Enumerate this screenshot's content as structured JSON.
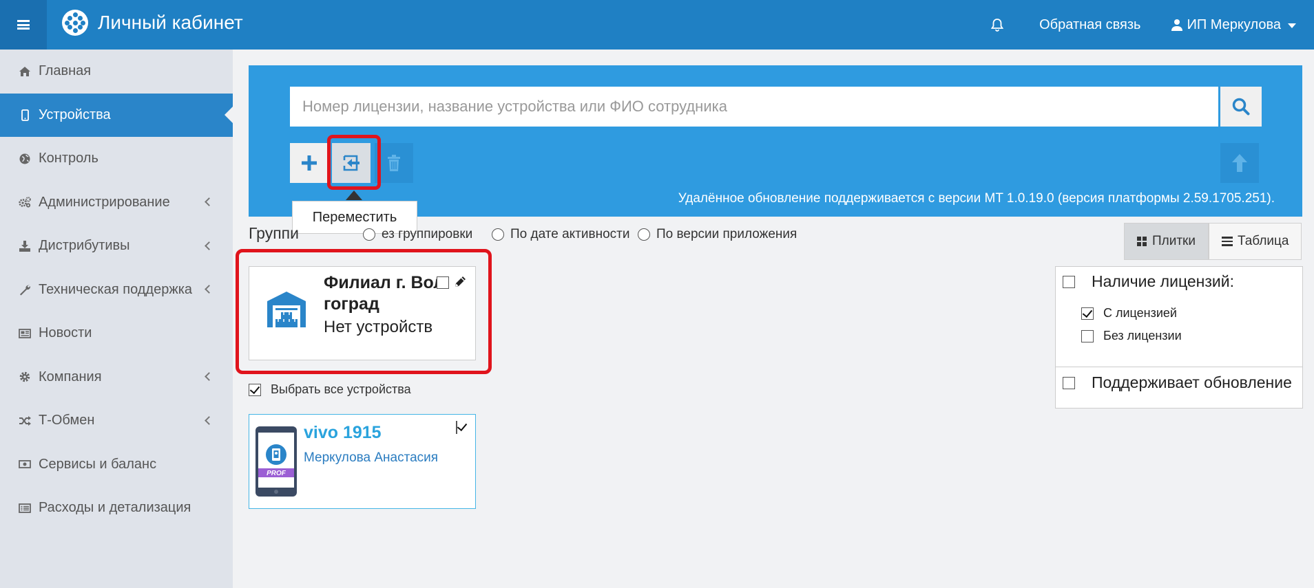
{
  "header": {
    "title": "Личный кабинет",
    "feedback": "Обратная связь",
    "user": "ИП Меркулова",
    "icons": [
      "menu-icon",
      "brand-logo",
      "bell-icon",
      "user-icon"
    ]
  },
  "sidebar": {
    "items": [
      {
        "label": "Главная",
        "icon": "home-icon",
        "active": false,
        "submenu": false
      },
      {
        "label": "Устройства",
        "icon": "mobile-icon",
        "active": true,
        "submenu": false
      },
      {
        "label": "Контроль",
        "icon": "globe-icon",
        "active": false,
        "submenu": false
      },
      {
        "label": "Администрирование",
        "icon": "gears-icon",
        "active": false,
        "submenu": true
      },
      {
        "label": "Дистрибутивы",
        "icon": "download-icon",
        "active": false,
        "submenu": true
      },
      {
        "label": "Техническая поддержка",
        "icon": "wrench-icon",
        "active": false,
        "submenu": true
      },
      {
        "label": "Новости",
        "icon": "newspaper-icon",
        "active": false,
        "submenu": false
      },
      {
        "label": "Компания",
        "icon": "gear-icon",
        "active": false,
        "submenu": true
      },
      {
        "label": "Т-Обмен",
        "icon": "shuffle-icon",
        "active": false,
        "submenu": true
      },
      {
        "label": "Сервисы и баланс",
        "icon": "money-icon",
        "active": false,
        "submenu": false
      },
      {
        "label": "Расходы и детализация",
        "icon": "list-alt-icon",
        "active": false,
        "submenu": false
      }
    ]
  },
  "search": {
    "placeholder": "Номер лицензии, название устройства или ФИО сотрудника"
  },
  "toolbar": {
    "tooltip": "Переместить",
    "note": "Удалённое обновление поддерживается с версии MT 1.0.19.0 (версия платформы 2.59.1705.251)."
  },
  "grouping": {
    "label": "Группировка",
    "options": [
      "Без группировки",
      "По дате активности",
      "По версии приложения"
    ],
    "visible_label": "Группи",
    "visible_opt0": "ез группировки"
  },
  "view": {
    "tiles": "Плитки",
    "table": "Таблица",
    "selected": "Плитки"
  },
  "group_card": {
    "title_line1": "Филиал г. Вол",
    "title_line2": "гоград",
    "subtitle": "Нет устройств"
  },
  "select_all": {
    "label": "Выбрать все устройства",
    "checked": true
  },
  "device": {
    "name": "vivo 1915",
    "user": "Меркулова Анастасия",
    "badge": "PROF",
    "checked": true
  },
  "filters": {
    "license_title": "Наличие лицензий:",
    "with_license": "С лицензией",
    "without_license": "Без лицензии",
    "update_title": "Поддерживает обновление"
  },
  "colors": {
    "header": "#1f80c4",
    "panel": "#2f9be0",
    "highlight": "#e0141c",
    "accent": "#2aa3dd"
  }
}
